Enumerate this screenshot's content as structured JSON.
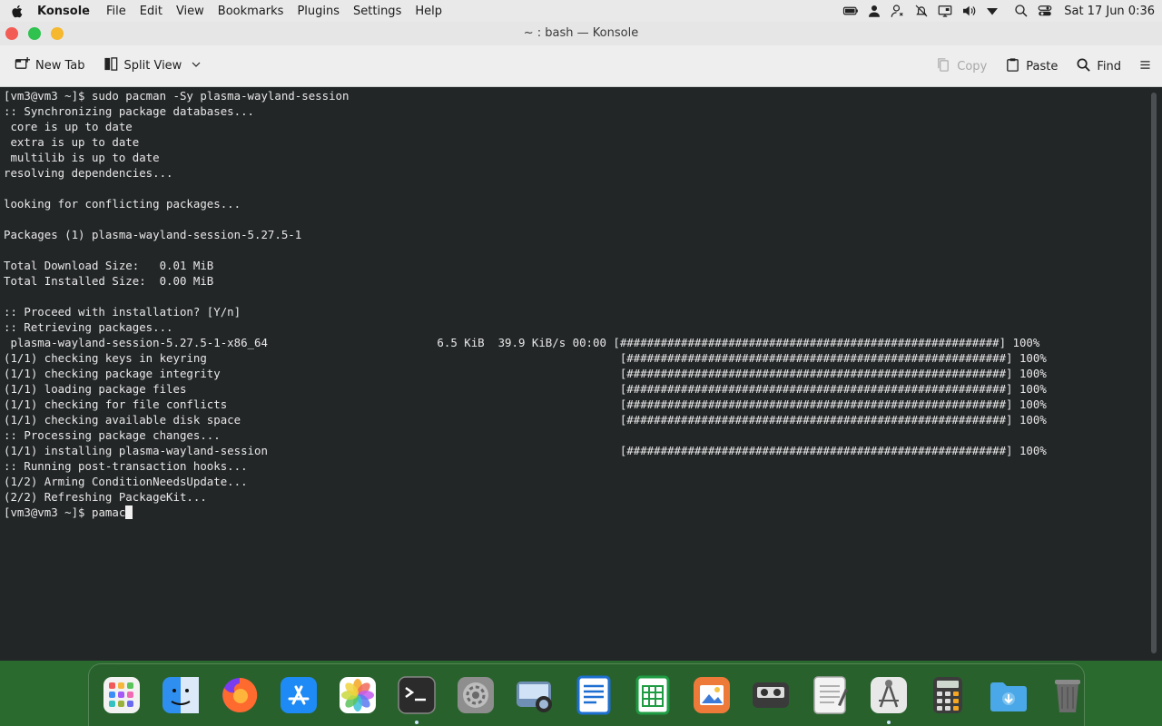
{
  "menubar": {
    "app_name": "Konsole",
    "items": [
      "File",
      "Edit",
      "View",
      "Bookmarks",
      "Plugins",
      "Settings",
      "Help"
    ],
    "clock": "Sat 17 Jun 0:36"
  },
  "window": {
    "title": "~ : bash — Konsole"
  },
  "toolbar": {
    "new_tab": "New Tab",
    "split_view": "Split View",
    "copy": "Copy",
    "paste": "Paste",
    "find": "Find"
  },
  "terminal": {
    "lines": [
      "[vm3@vm3 ~]$ sudo pacman -Sy plasma-wayland-session",
      ":: Synchronizing package databases...",
      " core is up to date",
      " extra is up to date",
      " multilib is up to date",
      "resolving dependencies...",
      "",
      "looking for conflicting packages...",
      "",
      "Packages (1) plasma-wayland-session-5.27.5-1",
      "",
      "Total Download Size:   0.01 MiB",
      "Total Installed Size:  0.00 MiB",
      "",
      ":: Proceed with installation? [Y/n]",
      ":: Retrieving packages...",
      " plasma-wayland-session-5.27.5-1-x86_64                         6.5 KiB  39.9 KiB/s 00:00 [########################################################] 100%",
      "(1/1) checking keys in keyring                                                             [########################################################] 100%",
      "(1/1) checking package integrity                                                           [########################################################] 100%",
      "(1/1) loading package files                                                                [########################################################] 100%",
      "(1/1) checking for file conflicts                                                          [########################################################] 100%",
      "(1/1) checking available disk space                                                        [########################################################] 100%",
      ":: Processing package changes...",
      "(1/1) installing plasma-wayland-session                                                    [########################################################] 100%",
      ":: Running post-transaction hooks...",
      "(1/2) Arming ConditionNeedsUpdate...",
      "(2/2) Refreshing PackageKit..."
    ],
    "prompt": "[vm3@vm3 ~]$ ",
    "current_input": "pamac"
  },
  "dock": {
    "apps": [
      {
        "name": "launchpad-icon",
        "color": "#f2f2f2"
      },
      {
        "name": "finder-icon",
        "color": "#2f8ff0"
      },
      {
        "name": "firefox-icon",
        "color": "#ff6a2e"
      },
      {
        "name": "app-store-icon",
        "color": "#1e8af5"
      },
      {
        "name": "photos-icon",
        "color": "#ffffff"
      },
      {
        "name": "terminal-icon",
        "color": "#2b2b2b"
      },
      {
        "name": "system-settings-icon",
        "color": "#8e8e8e"
      },
      {
        "name": "image-capture-icon",
        "color": "#6f8fb5"
      },
      {
        "name": "document-writer-icon",
        "color": "#1d6fd1"
      },
      {
        "name": "spreadsheet-icon",
        "color": "#1f9c43"
      },
      {
        "name": "image-viewer-icon",
        "color": "#ee7a3a"
      },
      {
        "name": "media-player-icon",
        "color": "#3a3a3a"
      },
      {
        "name": "text-editor-icon",
        "color": "#f3f3f3"
      },
      {
        "name": "screenshot-tool-icon",
        "color": "#e8e8e8"
      },
      {
        "name": "calculator-icon",
        "color": "#3c3c3c"
      },
      {
        "name": "downloads-folder-icon",
        "color": "#4aa7e8"
      },
      {
        "name": "trash-icon",
        "color": "#6c6c6c"
      }
    ]
  }
}
